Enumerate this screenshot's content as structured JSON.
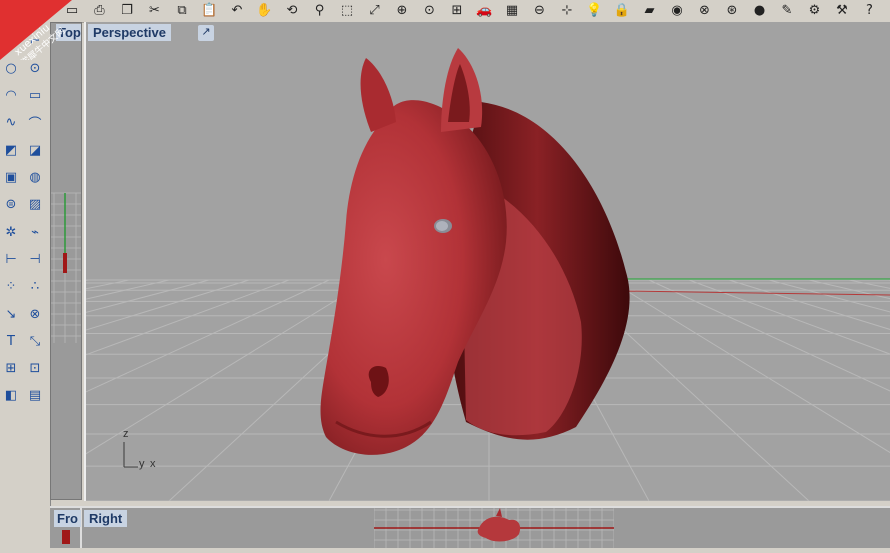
{
  "watermark": {
    "line1": "xuexiniu",
    "line2": "学犀牛中文网"
  },
  "toolbar": {
    "icons": [
      {
        "name": "new-file-icon",
        "glyph": "▭"
      },
      {
        "name": "print-icon",
        "glyph": "⎙"
      },
      {
        "name": "copy-icon",
        "glyph": "❐"
      },
      {
        "name": "cut-icon",
        "glyph": "✂"
      },
      {
        "name": "copy2-icon",
        "glyph": "⧉"
      },
      {
        "name": "paste-icon",
        "glyph": "📋"
      },
      {
        "name": "undo-icon",
        "glyph": "↶"
      },
      {
        "name": "pan-icon",
        "glyph": "✋"
      },
      {
        "name": "rotate-view-icon",
        "glyph": "⟲"
      },
      {
        "name": "zoom-icon",
        "glyph": "⚲"
      },
      {
        "name": "zoom-window-icon",
        "glyph": "⬚"
      },
      {
        "name": "zoom-extents-icon",
        "glyph": "⤢"
      },
      {
        "name": "zoom-selected-icon",
        "glyph": "⊕"
      },
      {
        "name": "zoom-target-icon",
        "glyph": "⊙"
      },
      {
        "name": "four-viewports-icon",
        "glyph": "⊞"
      },
      {
        "name": "car-icon",
        "glyph": "🚗"
      },
      {
        "name": "grid-plane-icon",
        "glyph": "▦"
      },
      {
        "name": "osnap-icon",
        "glyph": "⊖"
      },
      {
        "name": "select-points-icon",
        "glyph": "⊹"
      },
      {
        "name": "light-icon",
        "glyph": "💡"
      },
      {
        "name": "lock-icon",
        "glyph": "🔒"
      },
      {
        "name": "layer-icon",
        "glyph": "▰"
      },
      {
        "name": "color-wheel-icon",
        "glyph": "◉"
      },
      {
        "name": "wireframe-sphere-icon",
        "glyph": "⊗"
      },
      {
        "name": "shaded-sphere-icon",
        "glyph": "⊛"
      },
      {
        "name": "rendered-sphere-icon",
        "glyph": "●"
      },
      {
        "name": "pencil-icon",
        "glyph": "✎"
      },
      {
        "name": "options-gear-icon",
        "glyph": "⚙"
      },
      {
        "name": "tools-icon",
        "glyph": "⚒"
      },
      {
        "name": "help-icon",
        "glyph": "?"
      }
    ]
  },
  "sidebar": {
    "icons": [
      "point-icon",
      "polyline-icon",
      "circle-icon",
      "ellipse-icon",
      "arc-icon",
      "rectangle-icon",
      "freeform-curve-icon",
      "fillet-curve-icon",
      "surface-icon",
      "extrude-icon",
      "box-icon",
      "sphere-icon",
      "cylinder-icon",
      "mesh-icon",
      "transform-icon",
      "boolean-icon",
      "dimension-icon",
      "split-icon",
      "group-icon",
      "explode-icon",
      "curve-tools-icon",
      "analyze-icon",
      "text-icon",
      "scale-icon",
      "array-icon",
      "edit-points-icon",
      "solid-tools-icon",
      "render-icon"
    ]
  },
  "viewports": {
    "top_label": "Top",
    "perspective_label": "Perspective",
    "front_label": "Fro",
    "right_label": "Right",
    "axis_z": "z",
    "axis_y": "y",
    "axis_x": "x"
  },
  "colors": {
    "horse": "#b5383c",
    "viewport_bg": "#a2a2a2",
    "grid": "#b6b6b6",
    "label_bg": "#c8d3e2"
  }
}
